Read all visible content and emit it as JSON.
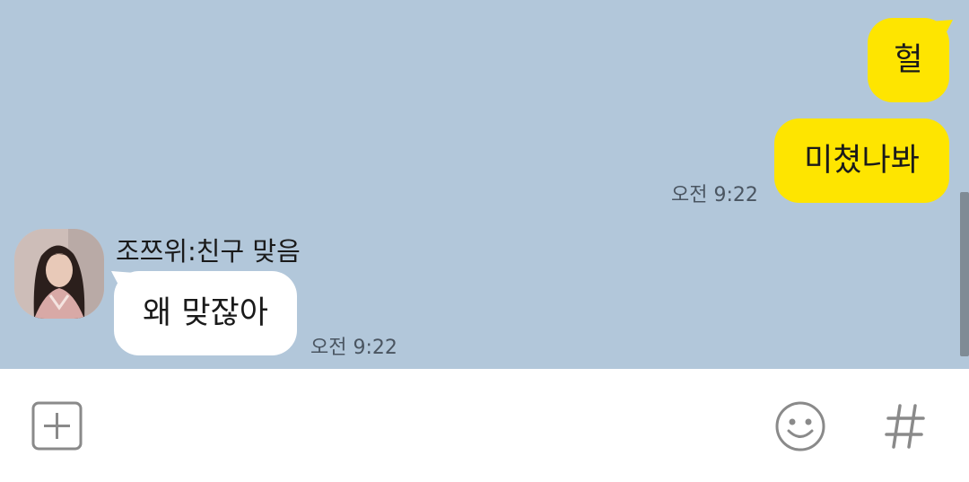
{
  "messages": {
    "me": [
      {
        "text": "헐"
      },
      {
        "text": "미쳤나봐",
        "time": "오전 9:22"
      }
    ],
    "other": {
      "sender": "조쯔위:친구 맞음",
      "text": "왜 맞잖아",
      "time": "오전 9:22"
    }
  },
  "icons": {
    "attach": "plus-square-icon",
    "emoji": "smiley-icon",
    "hashtag": "hashtag-icon"
  },
  "colors": {
    "chat_background": "#b2c7da",
    "my_bubble": "#fee500",
    "other_bubble": "#ffffff",
    "input_background": "#ffffff",
    "icon_gray": "#8a8a8a"
  }
}
